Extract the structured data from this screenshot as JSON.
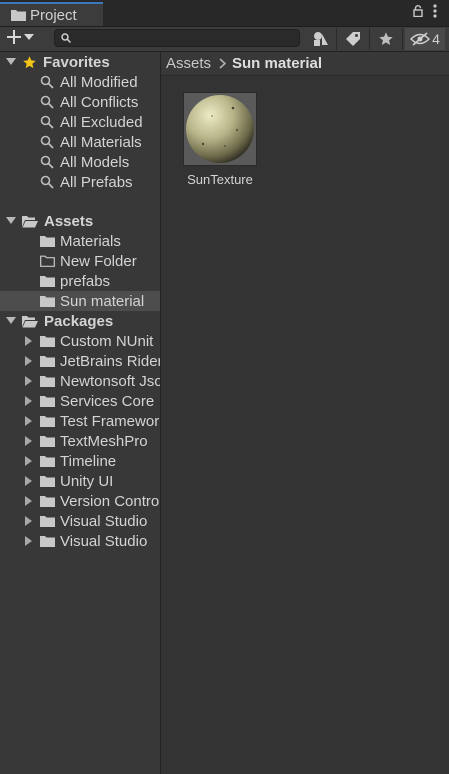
{
  "tab": {
    "title": "Project",
    "hidden_count": "4"
  },
  "search": {
    "placeholder": "",
    "value": ""
  },
  "tree": {
    "favorites": {
      "label": "Favorites",
      "items": [
        "All Modified",
        "All Conflicts",
        "All Excluded",
        "All Materials",
        "All Models",
        "All Prefabs"
      ]
    },
    "assets": {
      "label": "Assets",
      "items": [
        "Materials",
        "New Folder",
        "prefabs",
        "Sun material"
      ],
      "selected": "Sun material"
    },
    "packages": {
      "label": "Packages",
      "items": [
        "Custom NUnit",
        "JetBrains Rider",
        "Newtonsoft Json",
        "Services Core",
        "Test Framework",
        "TextMeshPro",
        "Timeline",
        "Unity UI",
        "Version Control",
        "Visual Studio",
        "Visual Studio"
      ]
    }
  },
  "breadcrumb": {
    "root": "Assets",
    "current": "Sun material"
  },
  "grid": {
    "items": [
      {
        "label": "SunTexture"
      }
    ]
  },
  "colors": {
    "accent": "#3a79bb",
    "star": "#f5c518",
    "selection": "#4d4d4d"
  }
}
